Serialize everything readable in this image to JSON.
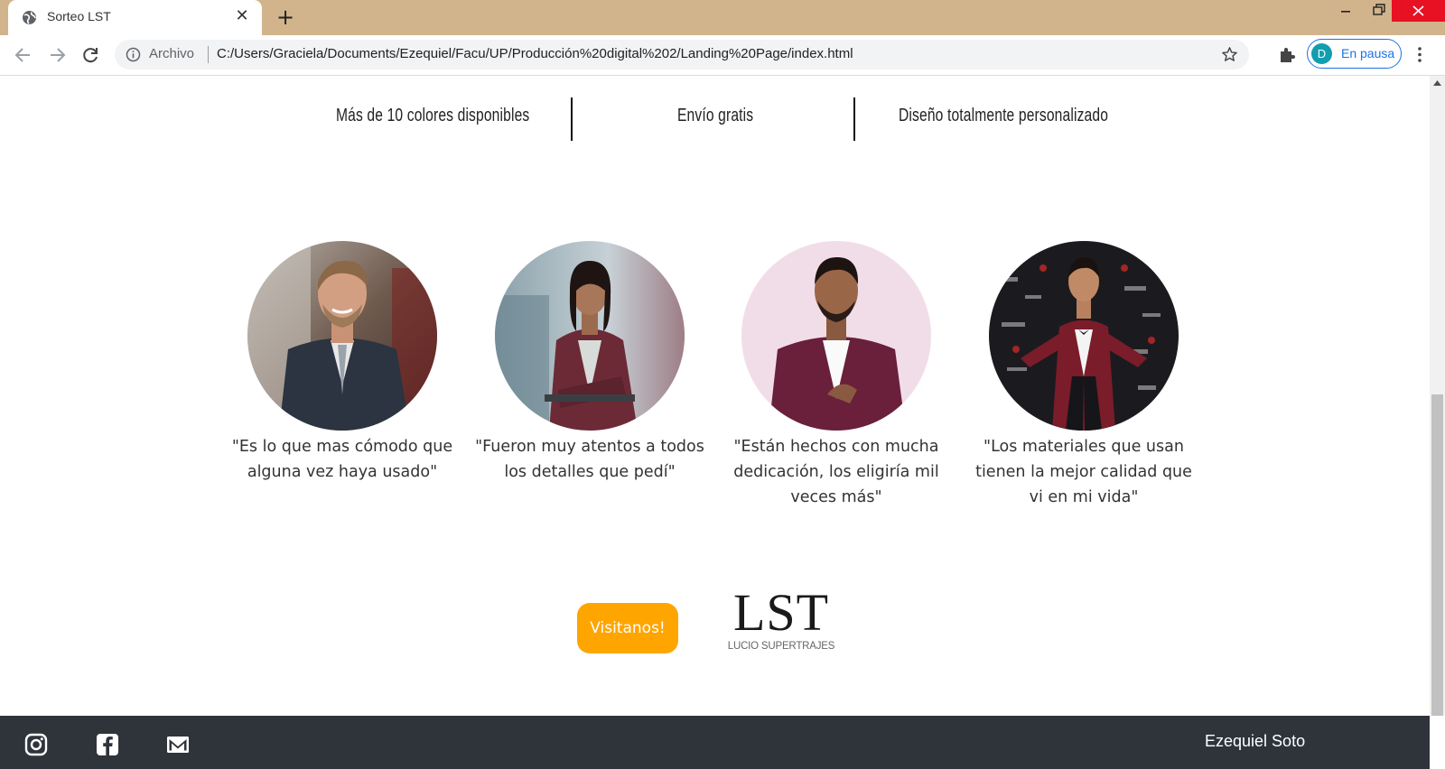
{
  "browser": {
    "tab": {
      "title": "Sorteo LST",
      "close_label": "✕",
      "favicon": "globe-icon"
    },
    "new_tab_label": "+",
    "window_buttons": [
      "minimize-icon",
      "restore-icon",
      "close-icon"
    ],
    "colors": {
      "titlebar": "#d2b48c",
      "close_button": "#e81123",
      "accent": "#1a73e8"
    },
    "address_bar": {
      "scheme_label": "Archivo",
      "url": "C:/Users/Graciela/Documents/Ezequiel/Facu/UP/Producción%20digital%202/Landing%20Page/index.html"
    },
    "profile": {
      "initial": "D",
      "status": "En pausa"
    }
  },
  "features": [
    {
      "label": "Más de 10 colores disponibles"
    },
    {
      "label": "Envío gratis"
    },
    {
      "label": "Diseño totalmente personalizado"
    }
  ],
  "testimonials": [
    {
      "quote": "\"Es lo que mas cómodo que alguna vez haya usado\"",
      "photo": "man-in-grey-suit"
    },
    {
      "quote": "\"Fueron muy atentos a todos los detalles que pedí\"",
      "photo": "woman-in-burgundy-blazer"
    },
    {
      "quote": "\"Están hechos con mucha dedicación, los eligiría mil veces más\"",
      "photo": "man-in-burgundy-suit"
    },
    {
      "quote": "\"Los materiales que usan tienen la mejor calidad que vi en mi vida\"",
      "photo": "man-in-red-tuxedo"
    }
  ],
  "cta": {
    "label": "Visitanos!",
    "color": "#ffa500"
  },
  "brand": {
    "mark": "LST",
    "name": "LUCIO SUPERTRAJES"
  },
  "footer": {
    "socials": [
      "instagram-icon",
      "facebook-icon",
      "mail-icon"
    ],
    "author": "Ezequiel Soto",
    "background": "#2f343b"
  }
}
